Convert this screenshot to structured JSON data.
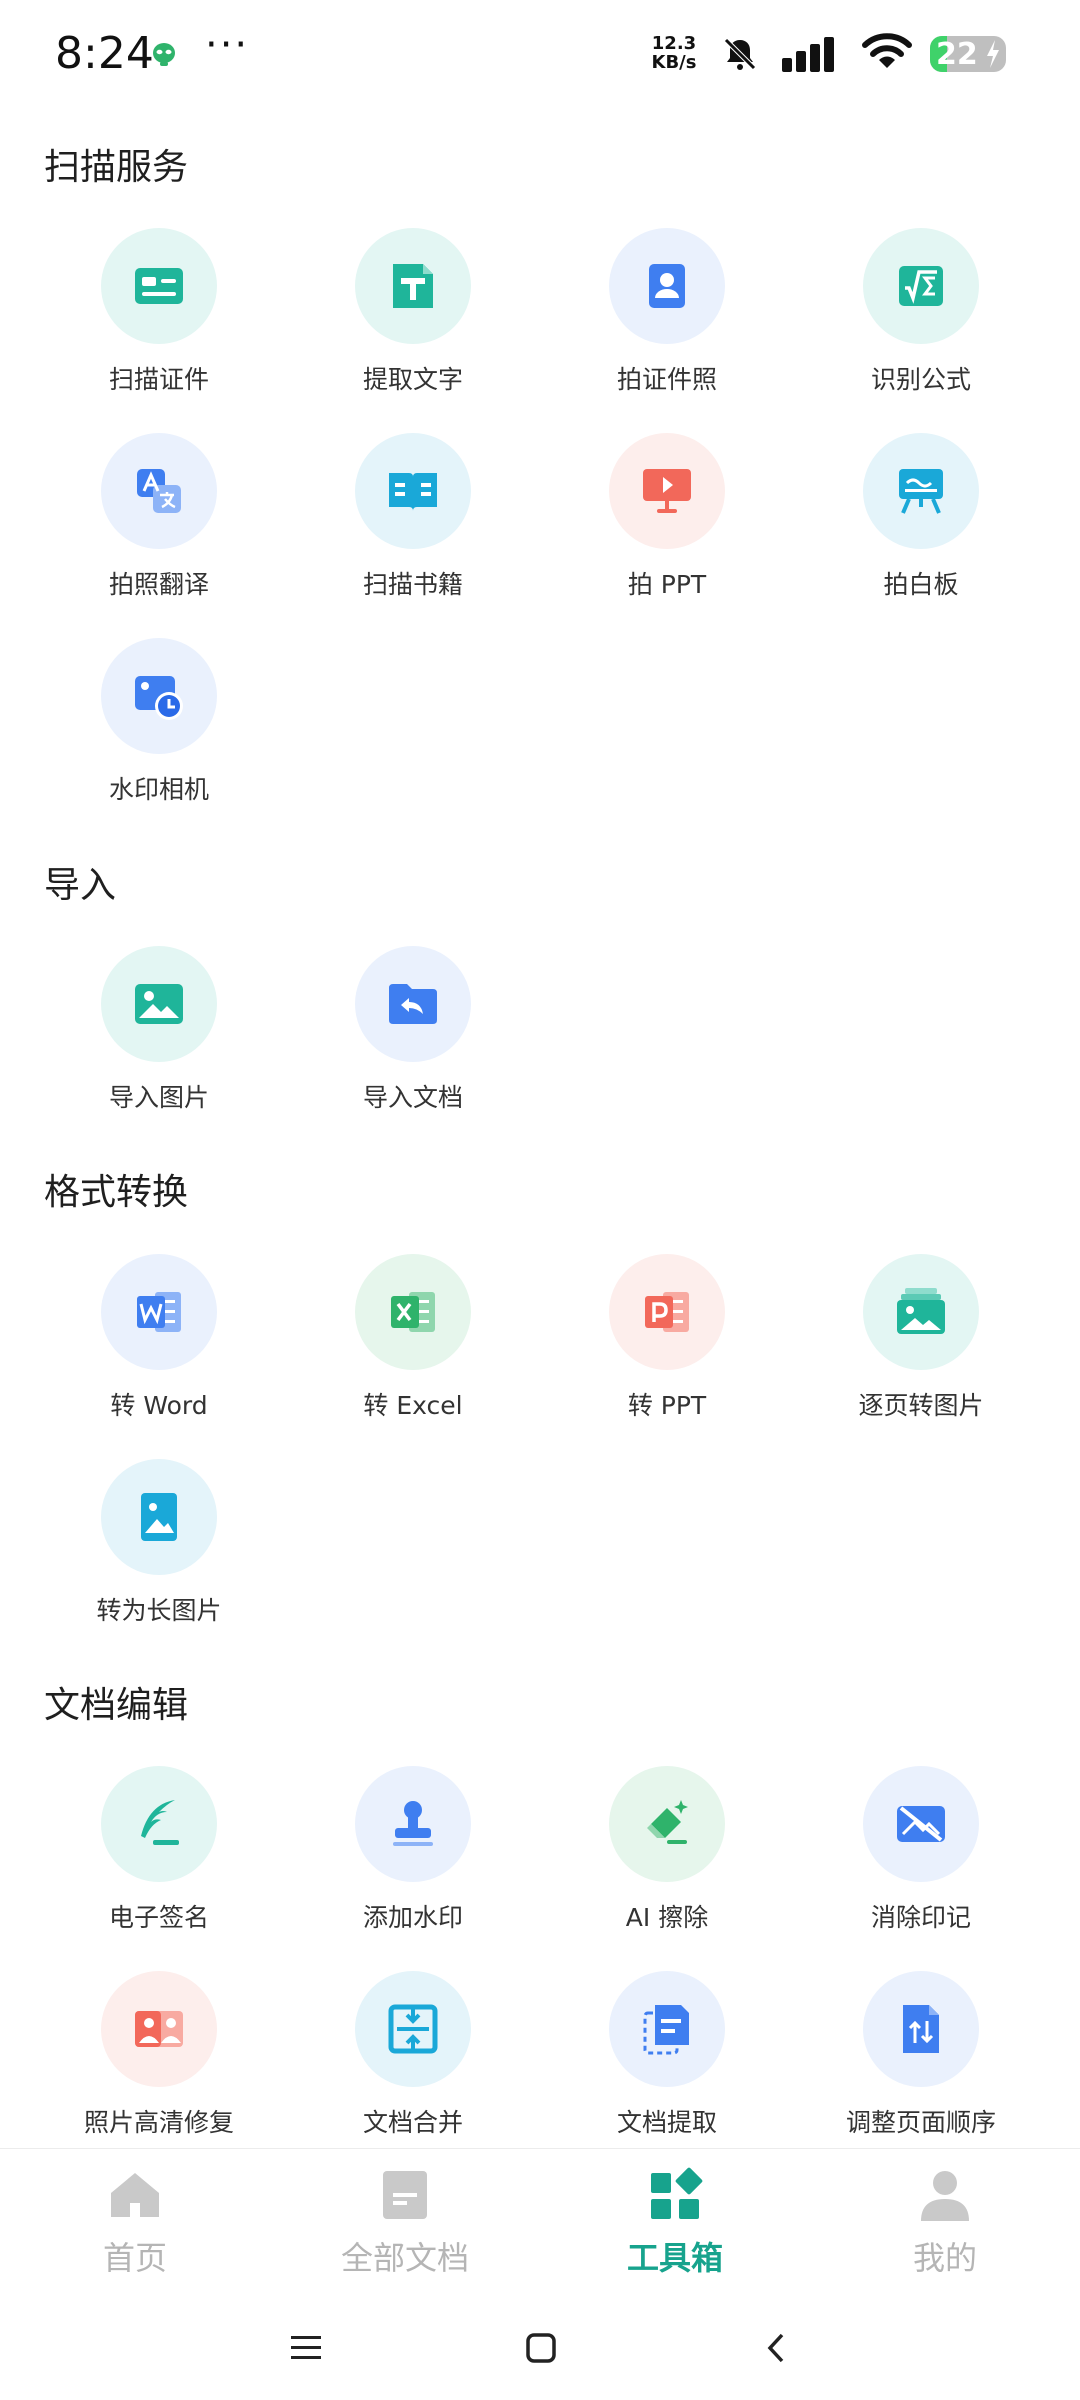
{
  "status_bar": {
    "time": "8:24",
    "dots": "···",
    "net_speed_value": "12.3",
    "net_speed_unit": "KB/s",
    "battery_level": "22",
    "battery_fraction": 0.22,
    "icons": [
      "alien-icon",
      "mute-icon",
      "signal-icon",
      "wifi-icon",
      "battery-icon",
      "charging-icon"
    ]
  },
  "sections": {
    "scan": {
      "title": "扫描服务",
      "items": [
        {
          "label": "扫描证件",
          "icon": "id-card-icon"
        },
        {
          "label": "提取文字",
          "icon": "text-extract-icon"
        },
        {
          "label": "拍证件照",
          "icon": "id-photo-icon"
        },
        {
          "label": "识别公式",
          "icon": "formula-icon"
        },
        {
          "label": "拍照翻译",
          "icon": "translate-icon"
        },
        {
          "label": "扫描书籍",
          "icon": "book-icon"
        },
        {
          "label": "拍 PPT",
          "icon": "presentation-icon"
        },
        {
          "label": "拍白板",
          "icon": "whiteboard-icon"
        },
        {
          "label": "水印相机",
          "icon": "watermark-camera-icon"
        }
      ]
    },
    "import": {
      "title": "导入",
      "items": [
        {
          "label": "导入图片",
          "icon": "image-icon"
        },
        {
          "label": "导入文档",
          "icon": "folder-import-icon"
        }
      ]
    },
    "convert": {
      "title": "格式转换",
      "items": [
        {
          "label": "转 Word",
          "icon": "word-icon"
        },
        {
          "label": "转 Excel",
          "icon": "excel-icon"
        },
        {
          "label": "转 PPT",
          "icon": "ppt-icon"
        },
        {
          "label": "逐页转图片",
          "icon": "images-stack-icon"
        },
        {
          "label": "转为长图片",
          "icon": "long-image-icon"
        }
      ]
    },
    "edit": {
      "title": "文档编辑",
      "items": [
        {
          "label": "电子签名",
          "icon": "signature-icon"
        },
        {
          "label": "添加水印",
          "icon": "stamp-icon"
        },
        {
          "label": "AI 擦除",
          "icon": "eraser-icon"
        },
        {
          "label": "消除印记",
          "icon": "remove-mark-icon"
        },
        {
          "label": "照片高清修复",
          "icon": "photo-restore-icon"
        },
        {
          "label": "文档合并",
          "icon": "merge-icon"
        },
        {
          "label": "文档提取",
          "icon": "extract-pages-icon"
        },
        {
          "label": "调整页面顺序",
          "icon": "reorder-icon"
        }
      ]
    }
  },
  "bottom_nav": {
    "home": "首页",
    "all_docs": "全部文档",
    "toolbox": "工具箱",
    "mine": "我的",
    "active": "toolbox"
  },
  "colors": {
    "accent": "#17a38d",
    "teal": "#1fb59a",
    "blue": "#3f7ef0",
    "red": "#f2685a",
    "cyan": "#1aa8d8",
    "green": "#2fb36b",
    "nav_inactive": "#b5b5b5"
  }
}
